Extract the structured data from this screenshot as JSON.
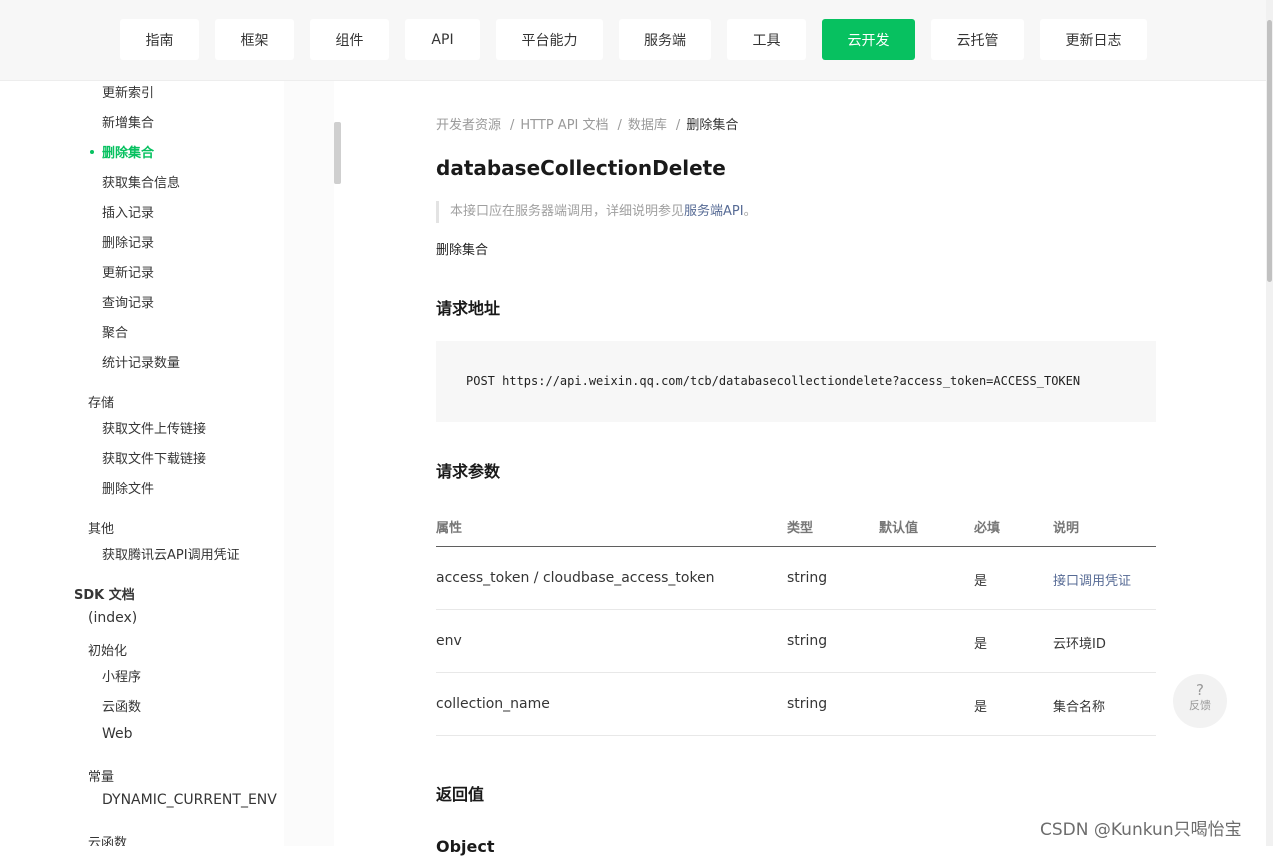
{
  "nav": {
    "tabs": [
      {
        "label": "指南"
      },
      {
        "label": "框架"
      },
      {
        "label": "组件"
      },
      {
        "label": "API"
      },
      {
        "label": "平台能力"
      },
      {
        "label": "服务端"
      },
      {
        "label": "工具"
      },
      {
        "label": "云开发",
        "active": true
      },
      {
        "label": "云托管"
      },
      {
        "label": "更新日志"
      }
    ]
  },
  "sidebar": {
    "items": [
      {
        "label": "更新索引"
      },
      {
        "label": "新增集合"
      },
      {
        "label": "删除集合",
        "active": true
      },
      {
        "label": "获取集合信息"
      },
      {
        "label": "插入记录"
      },
      {
        "label": "删除记录"
      },
      {
        "label": "更新记录"
      },
      {
        "label": "查询记录"
      },
      {
        "label": "聚合"
      },
      {
        "label": "统计记录数量"
      }
    ],
    "storage": {
      "title": "存储",
      "items": [
        {
          "label": "获取文件上传链接"
        },
        {
          "label": "获取文件下载链接"
        },
        {
          "label": "删除文件"
        }
      ]
    },
    "other": {
      "title": "其他",
      "items": [
        {
          "label": "获取腾讯云API调用凭证"
        }
      ]
    },
    "sdk": {
      "title": "SDK 文档",
      "index": "(index)",
      "init": "初始化",
      "init_items": [
        {
          "label": "小程序"
        },
        {
          "label": "云函数"
        },
        {
          "label": "Web"
        }
      ],
      "const": "常量",
      "const_items": [
        {
          "label": "DYNAMIC_CURRENT_ENV"
        }
      ],
      "cloudfunc": "云函数"
    }
  },
  "breadcrumb": {
    "items": [
      "开发者资源",
      "HTTP API 文档",
      "数据库"
    ],
    "current": "删除集合"
  },
  "page": {
    "title": "databaseCollectionDelete",
    "note_prefix": "本接口应在服务器端调用，详细说明参见",
    "note_link": "服务端API",
    "note_suffix": "。",
    "description": "删除集合",
    "section_url": "请求地址",
    "url": "POST https://api.weixin.qq.com/tcb/databasecollectiondelete?access_token=ACCESS_TOKEN",
    "section_params": "请求参数",
    "section_return": "返回值",
    "section_object": "Object"
  },
  "params_table": {
    "headers": [
      "属性",
      "类型",
      "默认值",
      "必填",
      "说明"
    ],
    "rows": [
      {
        "name": "access_token / cloudbase_access_token",
        "type": "string",
        "default": "",
        "required": "是",
        "desc": "接口调用凭证",
        "desc_link": true
      },
      {
        "name": "env",
        "type": "string",
        "default": "",
        "required": "是",
        "desc": "云环境ID"
      },
      {
        "name": "collection_name",
        "type": "string",
        "default": "",
        "required": "是",
        "desc": "集合名称"
      }
    ]
  },
  "feedback": {
    "icon": "?",
    "label": "反馈"
  },
  "watermark": "CSDN @Kunkun只喝怡宝",
  "colors": {
    "accent": "#07c160",
    "link": "#576b95",
    "nav_bg": "#f7f7f7",
    "code_bg": "#f7f7f7"
  }
}
